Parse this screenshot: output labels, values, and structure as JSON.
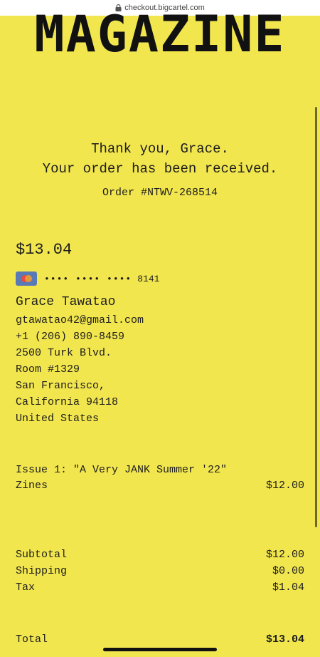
{
  "browser": {
    "url": "checkout.bigcartel.com"
  },
  "brand": {
    "title": "MAGAZINE"
  },
  "confirmation": {
    "line1": "Thank you, Grace.",
    "line2": "Your order has been received.",
    "order_number": "Order #NTWV-268514"
  },
  "payment": {
    "amount": "$13.04",
    "card_icon": "mastercard-icon",
    "card_mask": "•••• •••• ••••",
    "card_last4": "8141"
  },
  "customer": {
    "name": "Grace Tawatao",
    "email": "gtawatao42@gmail.com",
    "phone": "+1 (206) 890-8459",
    "address_lines": [
      "2500 Turk Blvd.",
      "Room #1329",
      "San Francisco,",
      "California 94118",
      "United States"
    ]
  },
  "items": [
    {
      "name": "Issue 1: \"A Very JANK Summer '22\"",
      "variant": "Zines",
      "price": "$12.00"
    }
  ],
  "summary": {
    "subtotal_label": "Subtotal",
    "subtotal": "$12.00",
    "shipping_label": "Shipping",
    "shipping": "$0.00",
    "tax_label": "Tax",
    "tax": "$1.04",
    "total_label": "Total",
    "total": "$13.04"
  },
  "colors": {
    "background": "#f2e64f",
    "text": "#1d1d1d"
  }
}
